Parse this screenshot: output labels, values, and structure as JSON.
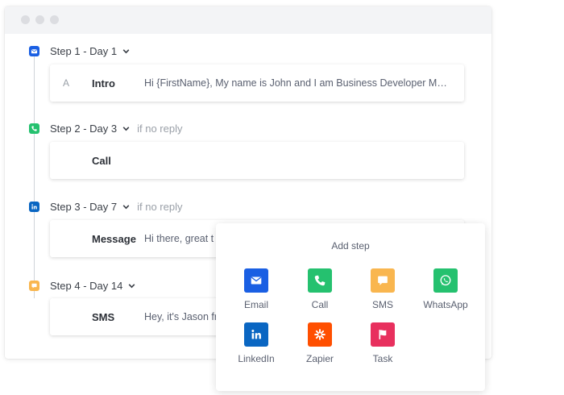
{
  "colors": {
    "email": "#1a5fe3",
    "call": "#25c16f",
    "sms": "#f9b64f",
    "whatsapp": "#25c16f",
    "linkedin": "#0a66c2",
    "zapier": "#ff4f00",
    "task": "#e8305e"
  },
  "steps": [
    {
      "icon": "email-icon",
      "title": "Step 1 - Day 1",
      "condition": "",
      "card_letter": "A",
      "label": "Intro",
      "preview": "Hi {FirstName},  My name is John and I am Business Developer Manager at"
    },
    {
      "icon": "phone-icon",
      "title": "Step 2 - Day 3",
      "condition": "if no reply",
      "card_letter": "",
      "label": "Call",
      "preview": ""
    },
    {
      "icon": "linkedin-icon",
      "title": "Step 3 - Day 7",
      "condition": "if no reply",
      "card_letter": "",
      "label": "Message",
      "preview": "Hi there, great t"
    },
    {
      "icon": "sms-icon",
      "title": "Step 4 - Day 14",
      "condition": "",
      "card_letter": "",
      "label": "SMS",
      "preview": "Hey, it's Jason fr"
    }
  ],
  "add_step": {
    "title": "Add step",
    "options": [
      {
        "label": "Email",
        "icon": "email-icon"
      },
      {
        "label": "Call",
        "icon": "phone-icon"
      },
      {
        "label": "SMS",
        "icon": "sms-icon"
      },
      {
        "label": "WhatsApp",
        "icon": "whatsapp-icon"
      },
      {
        "label": "LinkedIn",
        "icon": "linkedin-icon"
      },
      {
        "label": "Zapier",
        "icon": "zapier-icon"
      },
      {
        "label": "Task",
        "icon": "flag-icon"
      }
    ]
  }
}
